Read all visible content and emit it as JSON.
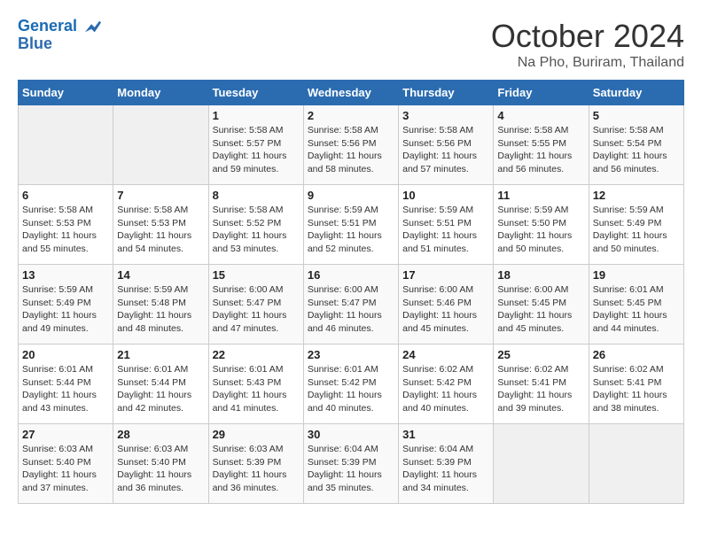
{
  "header": {
    "logo_line1": "General",
    "logo_line2": "Blue",
    "month_title": "October 2024",
    "location": "Na Pho, Buriram, Thailand"
  },
  "weekdays": [
    "Sunday",
    "Monday",
    "Tuesday",
    "Wednesday",
    "Thursday",
    "Friday",
    "Saturday"
  ],
  "weeks": [
    [
      {
        "day": "",
        "sunrise": "",
        "sunset": "",
        "daylight": ""
      },
      {
        "day": "",
        "sunrise": "",
        "sunset": "",
        "daylight": ""
      },
      {
        "day": "1",
        "sunrise": "Sunrise: 5:58 AM",
        "sunset": "Sunset: 5:57 PM",
        "daylight": "Daylight: 11 hours and 59 minutes."
      },
      {
        "day": "2",
        "sunrise": "Sunrise: 5:58 AM",
        "sunset": "Sunset: 5:56 PM",
        "daylight": "Daylight: 11 hours and 58 minutes."
      },
      {
        "day": "3",
        "sunrise": "Sunrise: 5:58 AM",
        "sunset": "Sunset: 5:56 PM",
        "daylight": "Daylight: 11 hours and 57 minutes."
      },
      {
        "day": "4",
        "sunrise": "Sunrise: 5:58 AM",
        "sunset": "Sunset: 5:55 PM",
        "daylight": "Daylight: 11 hours and 56 minutes."
      },
      {
        "day": "5",
        "sunrise": "Sunrise: 5:58 AM",
        "sunset": "Sunset: 5:54 PM",
        "daylight": "Daylight: 11 hours and 56 minutes."
      }
    ],
    [
      {
        "day": "6",
        "sunrise": "Sunrise: 5:58 AM",
        "sunset": "Sunset: 5:53 PM",
        "daylight": "Daylight: 11 hours and 55 minutes."
      },
      {
        "day": "7",
        "sunrise": "Sunrise: 5:58 AM",
        "sunset": "Sunset: 5:53 PM",
        "daylight": "Daylight: 11 hours and 54 minutes."
      },
      {
        "day": "8",
        "sunrise": "Sunrise: 5:58 AM",
        "sunset": "Sunset: 5:52 PM",
        "daylight": "Daylight: 11 hours and 53 minutes."
      },
      {
        "day": "9",
        "sunrise": "Sunrise: 5:59 AM",
        "sunset": "Sunset: 5:51 PM",
        "daylight": "Daylight: 11 hours and 52 minutes."
      },
      {
        "day": "10",
        "sunrise": "Sunrise: 5:59 AM",
        "sunset": "Sunset: 5:51 PM",
        "daylight": "Daylight: 11 hours and 51 minutes."
      },
      {
        "day": "11",
        "sunrise": "Sunrise: 5:59 AM",
        "sunset": "Sunset: 5:50 PM",
        "daylight": "Daylight: 11 hours and 50 minutes."
      },
      {
        "day": "12",
        "sunrise": "Sunrise: 5:59 AM",
        "sunset": "Sunset: 5:49 PM",
        "daylight": "Daylight: 11 hours and 50 minutes."
      }
    ],
    [
      {
        "day": "13",
        "sunrise": "Sunrise: 5:59 AM",
        "sunset": "Sunset: 5:49 PM",
        "daylight": "Daylight: 11 hours and 49 minutes."
      },
      {
        "day": "14",
        "sunrise": "Sunrise: 5:59 AM",
        "sunset": "Sunset: 5:48 PM",
        "daylight": "Daylight: 11 hours and 48 minutes."
      },
      {
        "day": "15",
        "sunrise": "Sunrise: 6:00 AM",
        "sunset": "Sunset: 5:47 PM",
        "daylight": "Daylight: 11 hours and 47 minutes."
      },
      {
        "day": "16",
        "sunrise": "Sunrise: 6:00 AM",
        "sunset": "Sunset: 5:47 PM",
        "daylight": "Daylight: 11 hours and 46 minutes."
      },
      {
        "day": "17",
        "sunrise": "Sunrise: 6:00 AM",
        "sunset": "Sunset: 5:46 PM",
        "daylight": "Daylight: 11 hours and 45 minutes."
      },
      {
        "day": "18",
        "sunrise": "Sunrise: 6:00 AM",
        "sunset": "Sunset: 5:45 PM",
        "daylight": "Daylight: 11 hours and 45 minutes."
      },
      {
        "day": "19",
        "sunrise": "Sunrise: 6:01 AM",
        "sunset": "Sunset: 5:45 PM",
        "daylight": "Daylight: 11 hours and 44 minutes."
      }
    ],
    [
      {
        "day": "20",
        "sunrise": "Sunrise: 6:01 AM",
        "sunset": "Sunset: 5:44 PM",
        "daylight": "Daylight: 11 hours and 43 minutes."
      },
      {
        "day": "21",
        "sunrise": "Sunrise: 6:01 AM",
        "sunset": "Sunset: 5:44 PM",
        "daylight": "Daylight: 11 hours and 42 minutes."
      },
      {
        "day": "22",
        "sunrise": "Sunrise: 6:01 AM",
        "sunset": "Sunset: 5:43 PM",
        "daylight": "Daylight: 11 hours and 41 minutes."
      },
      {
        "day": "23",
        "sunrise": "Sunrise: 6:01 AM",
        "sunset": "Sunset: 5:42 PM",
        "daylight": "Daylight: 11 hours and 40 minutes."
      },
      {
        "day": "24",
        "sunrise": "Sunrise: 6:02 AM",
        "sunset": "Sunset: 5:42 PM",
        "daylight": "Daylight: 11 hours and 40 minutes."
      },
      {
        "day": "25",
        "sunrise": "Sunrise: 6:02 AM",
        "sunset": "Sunset: 5:41 PM",
        "daylight": "Daylight: 11 hours and 39 minutes."
      },
      {
        "day": "26",
        "sunrise": "Sunrise: 6:02 AM",
        "sunset": "Sunset: 5:41 PM",
        "daylight": "Daylight: 11 hours and 38 minutes."
      }
    ],
    [
      {
        "day": "27",
        "sunrise": "Sunrise: 6:03 AM",
        "sunset": "Sunset: 5:40 PM",
        "daylight": "Daylight: 11 hours and 37 minutes."
      },
      {
        "day": "28",
        "sunrise": "Sunrise: 6:03 AM",
        "sunset": "Sunset: 5:40 PM",
        "daylight": "Daylight: 11 hours and 36 minutes."
      },
      {
        "day": "29",
        "sunrise": "Sunrise: 6:03 AM",
        "sunset": "Sunset: 5:39 PM",
        "daylight": "Daylight: 11 hours and 36 minutes."
      },
      {
        "day": "30",
        "sunrise": "Sunrise: 6:04 AM",
        "sunset": "Sunset: 5:39 PM",
        "daylight": "Daylight: 11 hours and 35 minutes."
      },
      {
        "day": "31",
        "sunrise": "Sunrise: 6:04 AM",
        "sunset": "Sunset: 5:39 PM",
        "daylight": "Daylight: 11 hours and 34 minutes."
      },
      {
        "day": "",
        "sunrise": "",
        "sunset": "",
        "daylight": ""
      },
      {
        "day": "",
        "sunrise": "",
        "sunset": "",
        "daylight": ""
      }
    ]
  ]
}
